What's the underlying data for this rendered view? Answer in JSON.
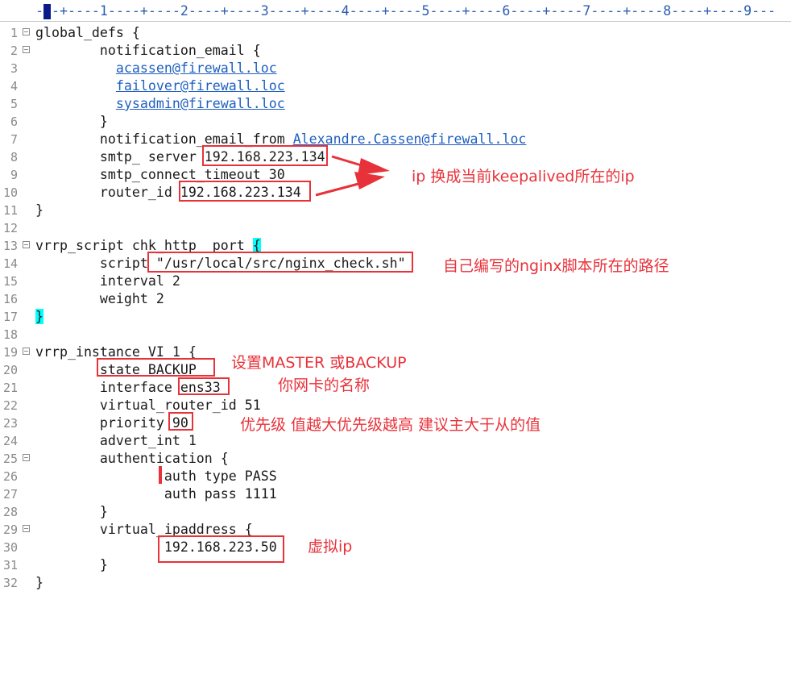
{
  "ruler": {
    "text": "---+----1----+----2----+----3----+----4----+----5----+----6----+----7----+----8----+----9---"
  },
  "lines": [
    {
      "n": "1",
      "fold": true,
      "parts": [
        {
          "t": "global_defs {"
        }
      ]
    },
    {
      "n": "2",
      "fold": true,
      "parts": [
        {
          "t": "        notification_email {"
        }
      ]
    },
    {
      "n": "3",
      "fold": false,
      "parts": [
        {
          "t": "          "
        },
        {
          "t": "acassen@firewall.loc",
          "link": true
        }
      ]
    },
    {
      "n": "4",
      "fold": false,
      "parts": [
        {
          "t": "          "
        },
        {
          "t": "failover@firewall.loc",
          "link": true
        }
      ]
    },
    {
      "n": "5",
      "fold": false,
      "parts": [
        {
          "t": "          "
        },
        {
          "t": "sysadmin@firewall.loc",
          "link": true
        }
      ]
    },
    {
      "n": "6",
      "fold": false,
      "parts": [
        {
          "t": "        }"
        }
      ]
    },
    {
      "n": "7",
      "fold": false,
      "parts": [
        {
          "t": "        notification_email_from "
        },
        {
          "t": "Alexandre.Cassen@firewall.loc",
          "link": true
        }
      ]
    },
    {
      "n": "8",
      "fold": false,
      "parts": [
        {
          "t": "        smtp_ server 192.168.223.134"
        }
      ]
    },
    {
      "n": "9",
      "fold": false,
      "parts": [
        {
          "t": "        smtp_connect_timeout 30"
        }
      ]
    },
    {
      "n": "10",
      "fold": false,
      "parts": [
        {
          "t": "        router_id 192.168.223.134"
        }
      ]
    },
    {
      "n": "11",
      "fold": false,
      "parts": [
        {
          "t": "}"
        }
      ]
    },
    {
      "n": "12",
      "fold": false,
      "parts": [
        {
          "t": ""
        }
      ]
    },
    {
      "n": "13",
      "fold": true,
      "parts": [
        {
          "t": "vrrp_script chk_http  port "
        },
        {
          "t": "{",
          "hl": true
        }
      ]
    },
    {
      "n": "14",
      "fold": false,
      "parts": [
        {
          "t": "        script \"/usr/local/src/nginx_check.sh\""
        }
      ]
    },
    {
      "n": "15",
      "fold": false,
      "parts": [
        {
          "t": "        interval 2"
        }
      ]
    },
    {
      "n": "16",
      "fold": false,
      "parts": [
        {
          "t": "        weight 2"
        }
      ]
    },
    {
      "n": "17",
      "fold": false,
      "parts": [
        {
          "t": "}",
          "hl": true
        }
      ]
    },
    {
      "n": "18",
      "fold": false,
      "parts": [
        {
          "t": ""
        }
      ]
    },
    {
      "n": "19",
      "fold": true,
      "parts": [
        {
          "t": "vrrp_instance VI 1 {"
        }
      ]
    },
    {
      "n": "20",
      "fold": false,
      "parts": [
        {
          "t": "        state BACKUP"
        }
      ]
    },
    {
      "n": "21",
      "fold": false,
      "parts": [
        {
          "t": "        interface ens33"
        }
      ]
    },
    {
      "n": "22",
      "fold": false,
      "parts": [
        {
          "t": "        virtual_router_id 51"
        }
      ]
    },
    {
      "n": "23",
      "fold": false,
      "parts": [
        {
          "t": "        priority 90"
        }
      ]
    },
    {
      "n": "24",
      "fold": false,
      "parts": [
        {
          "t": "        advert_int 1"
        }
      ]
    },
    {
      "n": "25",
      "fold": true,
      "parts": [
        {
          "t": "        authentication {"
        }
      ]
    },
    {
      "n": "26",
      "fold": false,
      "parts": [
        {
          "t": "                auth type PASS"
        }
      ]
    },
    {
      "n": "27",
      "fold": false,
      "parts": [
        {
          "t": "                auth pass 1111"
        }
      ]
    },
    {
      "n": "28",
      "fold": false,
      "parts": [
        {
          "t": "        }"
        }
      ]
    },
    {
      "n": "29",
      "fold": true,
      "parts": [
        {
          "t": "        virtual_ipaddress {"
        }
      ]
    },
    {
      "n": "30",
      "fold": false,
      "parts": [
        {
          "t": "                192.168.223.50"
        }
      ]
    },
    {
      "n": "31",
      "fold": false,
      "parts": [
        {
          "t": "        }"
        }
      ]
    },
    {
      "n": "32",
      "fold": false,
      "parts": [
        {
          "t": "}"
        }
      ]
    }
  ],
  "annotations": {
    "ip_note": "ip 换成当前keepalived所在的ip",
    "script_note": "自己编写的nginx脚本所在的路径",
    "state_note": "设置MASTER 或BACKUP",
    "interface_note": "你网卡的名称",
    "priority_note": "优先级 值越大优先级越高 建议主大于从的值",
    "vip_note": "虚拟ip"
  },
  "colors": {
    "annotation_red": "#e8323a",
    "link_blue": "#1f5fbf",
    "bracket_highlight": "#00ffff"
  }
}
